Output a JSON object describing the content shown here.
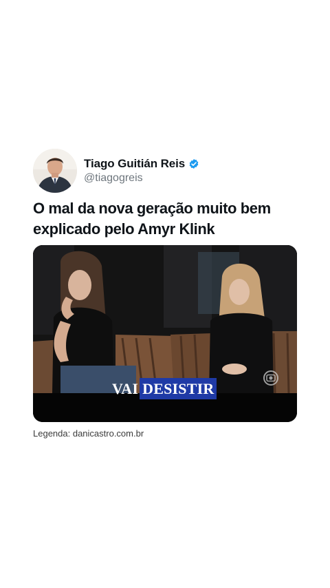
{
  "author": {
    "display_name": "Tiago Guitián Reis",
    "handle": "@tiagogreis",
    "verified": true,
    "avatar_icon": "avatar-photo"
  },
  "tweet": {
    "text": "O mal da nova geração muito bem explicado pelo Amyr Klink"
  },
  "media": {
    "type": "video-still",
    "caption_white": "VAI",
    "caption_highlight": "DESISTIR",
    "caption_highlight_color": "#1f3aa6",
    "watermark_icon": "globo-logo-icon"
  },
  "legend": "Legenda: danicastro.com.br",
  "colors": {
    "verified": "#1d9bf0",
    "text_primary": "#0f1419",
    "text_secondary": "#6e767d"
  }
}
